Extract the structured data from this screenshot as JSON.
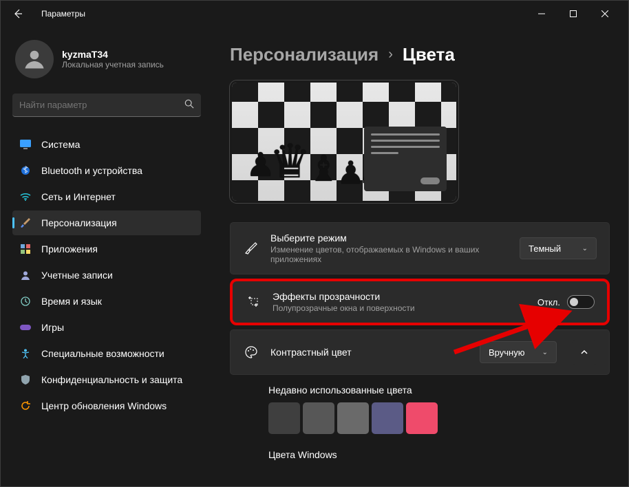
{
  "titlebar": {
    "title": "Параметры"
  },
  "user": {
    "name": "kyzmaT34",
    "subtitle": "Локальная учетная запись"
  },
  "search": {
    "placeholder": "Найти параметр"
  },
  "nav": {
    "items": [
      {
        "label": "Система",
        "icon": "system"
      },
      {
        "label": "Bluetooth и устройства",
        "icon": "bluetooth"
      },
      {
        "label": "Сеть и Интернет",
        "icon": "wifi"
      },
      {
        "label": "Персонализация",
        "icon": "brush",
        "active": true
      },
      {
        "label": "Приложения",
        "icon": "apps"
      },
      {
        "label": "Учетные записи",
        "icon": "accounts"
      },
      {
        "label": "Время и язык",
        "icon": "time"
      },
      {
        "label": "Игры",
        "icon": "games"
      },
      {
        "label": "Специальные возможности",
        "icon": "accessibility"
      },
      {
        "label": "Конфиденциальность и защита",
        "icon": "privacy"
      },
      {
        "label": "Центр обновления Windows",
        "icon": "update"
      }
    ]
  },
  "breadcrumb": {
    "parent": "Персонализация",
    "current": "Цвета"
  },
  "settings": {
    "mode": {
      "title": "Выберите режим",
      "subtitle": "Изменение цветов, отображаемых в Windows и ваших приложениях",
      "value": "Темный"
    },
    "transparency": {
      "title": "Эффекты прозрачности",
      "subtitle": "Полупрозрачные окна и поверхности",
      "toggle_label": "Откл.",
      "on": false
    },
    "accent": {
      "title": "Контрастный цвет",
      "value": "Вручную"
    }
  },
  "recent_colors": {
    "title": "Недавно использованные цвета",
    "colors": [
      "#3f3f3f",
      "#575757",
      "#6a6a6a",
      "#5b5b86",
      "#ef4b6b"
    ]
  },
  "windows_colors": {
    "title": "Цвета Windows"
  }
}
